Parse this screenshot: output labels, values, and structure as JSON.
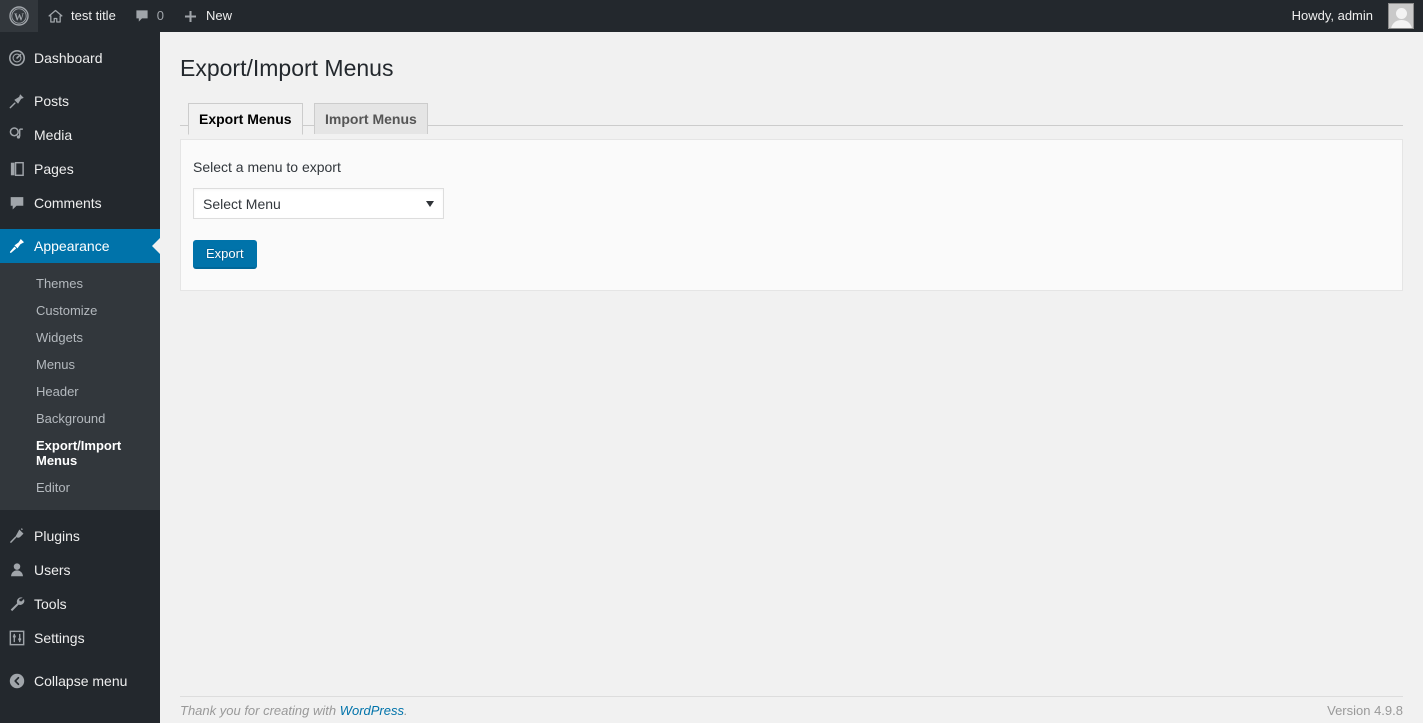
{
  "adminbar": {
    "wp_logo_icon": "wordpress-logo-icon",
    "site_name": "test title",
    "site_icon": "home-icon",
    "comments_icon": "comment-bubble-icon",
    "comments_count": "0",
    "new_icon": "plus-icon",
    "new_label": "New",
    "howdy": "Howdy, admin",
    "avatar": "user-avatar"
  },
  "sidebar": {
    "items": [
      {
        "label": "Dashboard",
        "icon": "dashboard-icon",
        "current": false
      },
      {
        "label": "Posts",
        "icon": "pin-icon",
        "current": false
      },
      {
        "label": "Media",
        "icon": "media-icon",
        "current": false
      },
      {
        "label": "Pages",
        "icon": "pages-icon",
        "current": false
      },
      {
        "label": "Comments",
        "icon": "comment-bubble-icon",
        "current": false
      },
      {
        "label": "Appearance",
        "icon": "paintbrush-icon",
        "current": true
      },
      {
        "label": "Plugins",
        "icon": "plugin-icon",
        "current": false
      },
      {
        "label": "Users",
        "icon": "user-icon",
        "current": false
      },
      {
        "label": "Tools",
        "icon": "wrench-icon",
        "current": false
      },
      {
        "label": "Settings",
        "icon": "sliders-icon",
        "current": false
      }
    ],
    "appearance_submenu": [
      {
        "label": "Themes",
        "current": false
      },
      {
        "label": "Customize",
        "current": false
      },
      {
        "label": "Widgets",
        "current": false
      },
      {
        "label": "Menus",
        "current": false
      },
      {
        "label": "Header",
        "current": false
      },
      {
        "label": "Background",
        "current": false
      },
      {
        "label": "Export/Import Menus",
        "current": true
      },
      {
        "label": "Editor",
        "current": false
      }
    ],
    "collapse": {
      "label": "Collapse menu",
      "icon": "collapse-arrow-icon"
    }
  },
  "main": {
    "page_title": "Export/Import Menus",
    "tabs": [
      {
        "label": "Export Menus",
        "active": true
      },
      {
        "label": "Import Menus",
        "active": false
      }
    ],
    "panel": {
      "label": "Select a menu to export",
      "select": {
        "selected": "Select Menu",
        "options": [
          "Select Menu"
        ]
      },
      "export_button": "Export"
    }
  },
  "footer": {
    "thankyou_prefix": "Thank you for creating with ",
    "wordpress_link": "WordPress",
    "thankyou_suffix": ".",
    "version": "Version 4.9.8"
  },
  "colors": {
    "admin_bg": "#23282d",
    "submenu_bg": "#32373c",
    "accent_blue": "#0073aa",
    "content_bg": "#f1f1f1"
  }
}
